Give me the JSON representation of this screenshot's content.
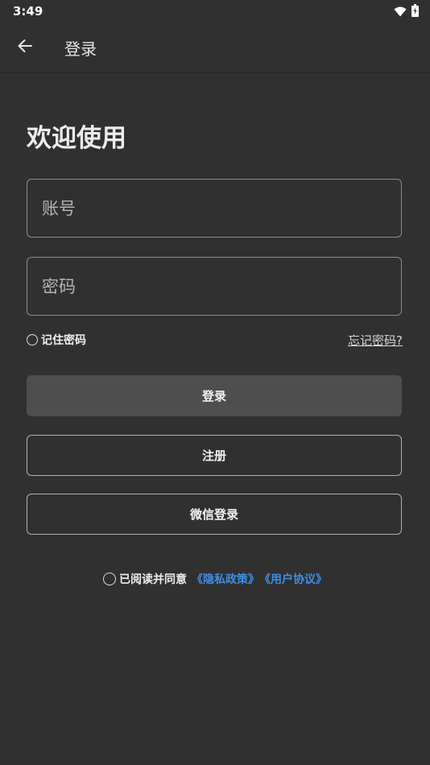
{
  "status_bar": {
    "time": "3:49",
    "icons": [
      "wifi-icon",
      "battery-charging-icon"
    ]
  },
  "app_bar": {
    "title": "登录",
    "back_icon": "arrow-left-icon"
  },
  "welcome": "欢迎使用",
  "form": {
    "account_placeholder": "账号",
    "account_value": "",
    "password_placeholder": "密码",
    "password_value": "",
    "remember_label": "记住密码",
    "remember_checked": false,
    "forgot_label": "忘记密码?"
  },
  "buttons": {
    "login": "登录",
    "register": "注册",
    "wechat": "微信登录"
  },
  "agreement": {
    "checked": false,
    "text": "已阅读并同意",
    "privacy_link": "《隐私政策》",
    "user_link": "《用户协议》"
  },
  "colors": {
    "background": "#303030",
    "login_button": "#4e4e4e",
    "link": "#3f8ee6",
    "border": "#8a8a8a"
  }
}
